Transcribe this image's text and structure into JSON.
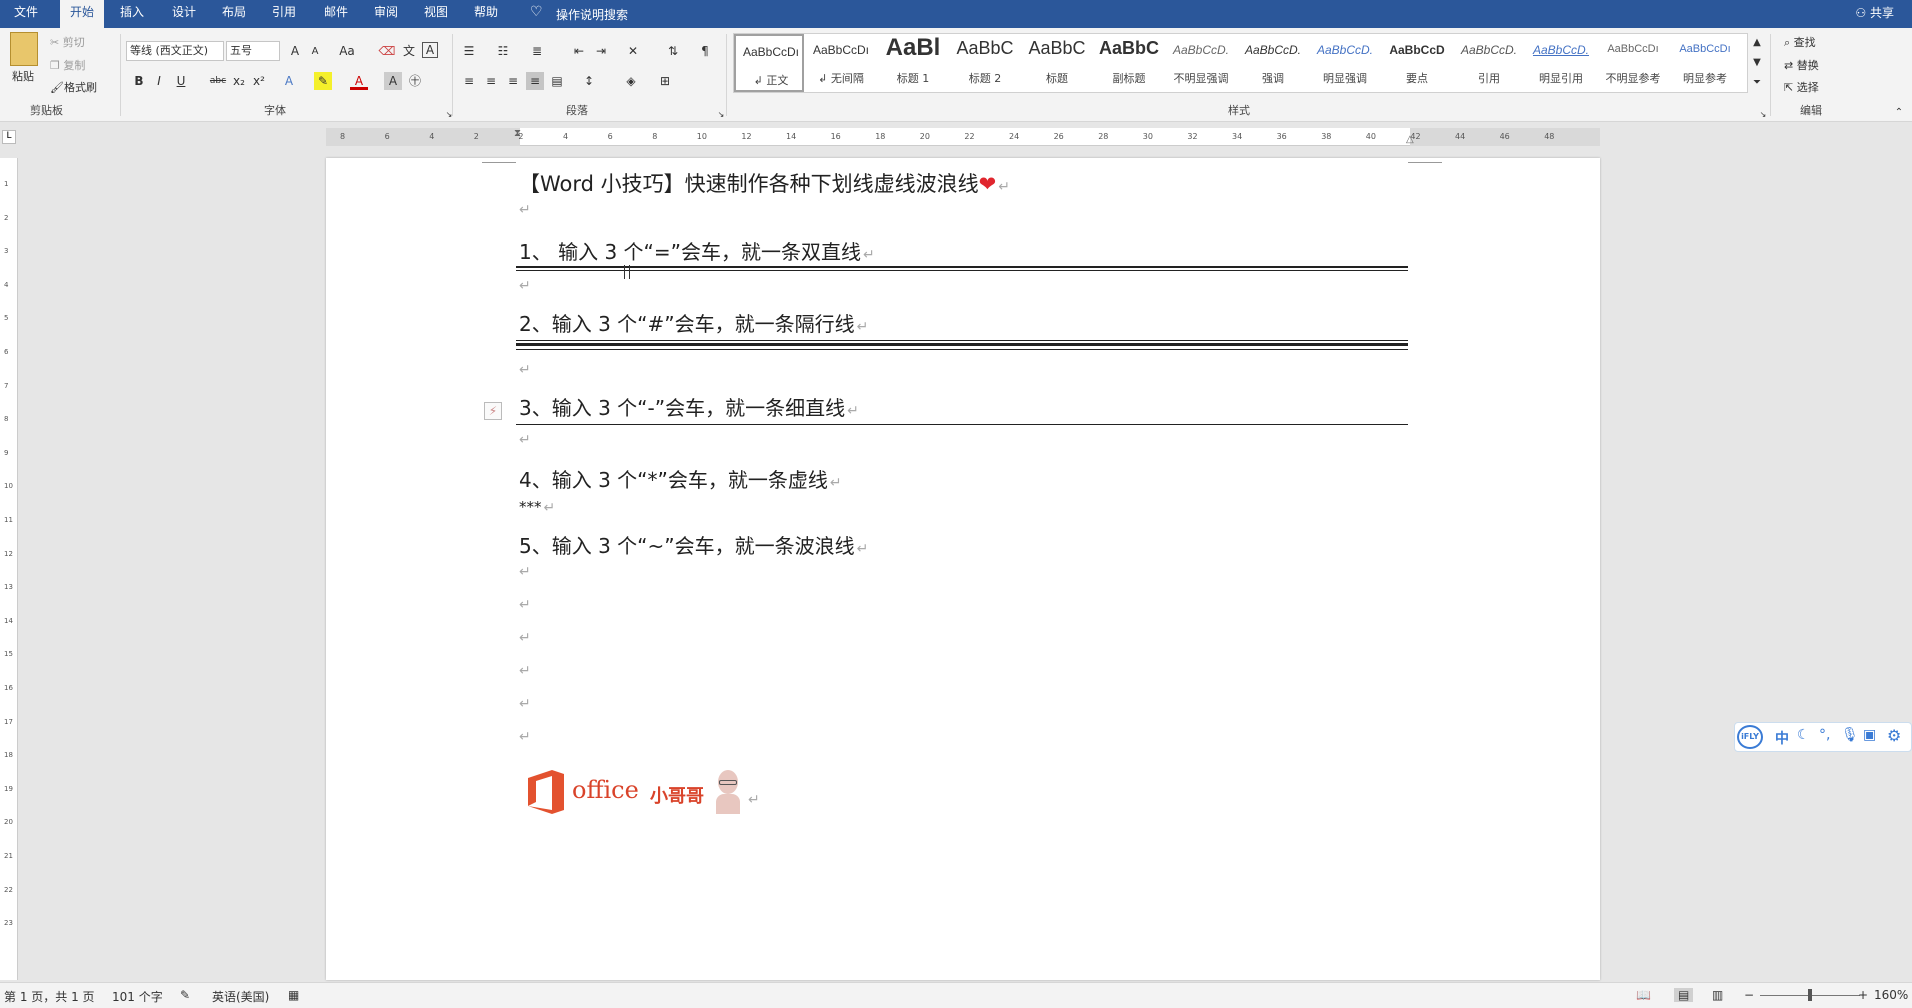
{
  "menu": {
    "items": [
      "文件",
      "开始",
      "插入",
      "设计",
      "布局",
      "引用",
      "邮件",
      "审阅",
      "视图",
      "帮助"
    ],
    "active": "开始",
    "tellme": "操作说明搜索",
    "share": "共享"
  },
  "clipboard": {
    "paste": "粘贴",
    "cut": "剪切",
    "copy": "复制",
    "painter": "格式刷",
    "label": "剪贴板"
  },
  "font": {
    "name": "等线 (西文正文)",
    "size": "五号",
    "label": "字体",
    "bold": "B",
    "italic": "I",
    "underline": "U",
    "strike": "abc",
    "sub": "x₂",
    "sup": "x²",
    "grow": "A",
    "shrink": "A",
    "case": "Aa"
  },
  "paragraph": {
    "label": "段落"
  },
  "styles": {
    "label": "样式",
    "tiles": [
      {
        "sample": "AaBbCcDı",
        "name": "↲ 正文"
      },
      {
        "sample": "AaBbCcDı",
        "name": "↲ 无间隔"
      },
      {
        "sample": "AaBl",
        "name": "标题 1"
      },
      {
        "sample": "AaBbC",
        "name": "标题 2"
      },
      {
        "sample": "AaBbC",
        "name": "标题"
      },
      {
        "sample": "AaBbC",
        "name": "副标题"
      },
      {
        "sample": "AaBbCcD.",
        "name": "不明显强调"
      },
      {
        "sample": "AaBbCcD.",
        "name": "强调"
      },
      {
        "sample": "AaBbCcD.",
        "name": "明显强调"
      },
      {
        "sample": "AaBbCcD",
        "name": "要点"
      },
      {
        "sample": "AaBbCcD.",
        "name": "引用"
      },
      {
        "sample": "AaBbCcD.",
        "name": "明显引用"
      },
      {
        "sample": "AaBbCcDı",
        "name": "不明显参考"
      },
      {
        "sample": "AaBbCcDı",
        "name": "明显参考"
      }
    ]
  },
  "editing": {
    "find": "查找",
    "replace": "替换",
    "select": "选择",
    "label": "编辑"
  },
  "ruler_marks": [
    "8",
    "6",
    "4",
    "2",
    "2",
    "4",
    "6",
    "8",
    "10",
    "12",
    "14",
    "16",
    "18",
    "20",
    "22",
    "24",
    "26",
    "28",
    "30",
    "32",
    "34",
    "36",
    "38",
    "40",
    "42",
    "44",
    "46",
    "48"
  ],
  "vruler_marks": [
    "1",
    "2",
    "3",
    "4",
    "5",
    "6",
    "7",
    "8",
    "9",
    "10",
    "11",
    "12",
    "13",
    "14",
    "15",
    "16",
    "17",
    "18",
    "19",
    "20",
    "21",
    "22",
    "23"
  ],
  "document": {
    "title": "【Word 小技巧】快速制作各种下划线虚线波浪线",
    "p1": "1、 输入 3 个“=”会车，就一条双直线",
    "p2": "2、输入 3 个“#”会车，就一条隔行线",
    "p3": "3、输入 3 个“-”会车，就一条细直线",
    "p4": "4、输入 3 个“*”会车，就一条虚线",
    "p4b": "***",
    "p5": "5、输入 3 个“~”会车，就一条波浪线",
    "pilcrow": "↵",
    "logo_text": "office",
    "logo_sub": "小哥哥"
  },
  "ime": {
    "brand": "iFLY",
    "mode": "中"
  },
  "status": {
    "page": "第 1 页，共 1 页",
    "words": "101 个字",
    "lang": "英语(美国)",
    "zoom": "160%"
  }
}
